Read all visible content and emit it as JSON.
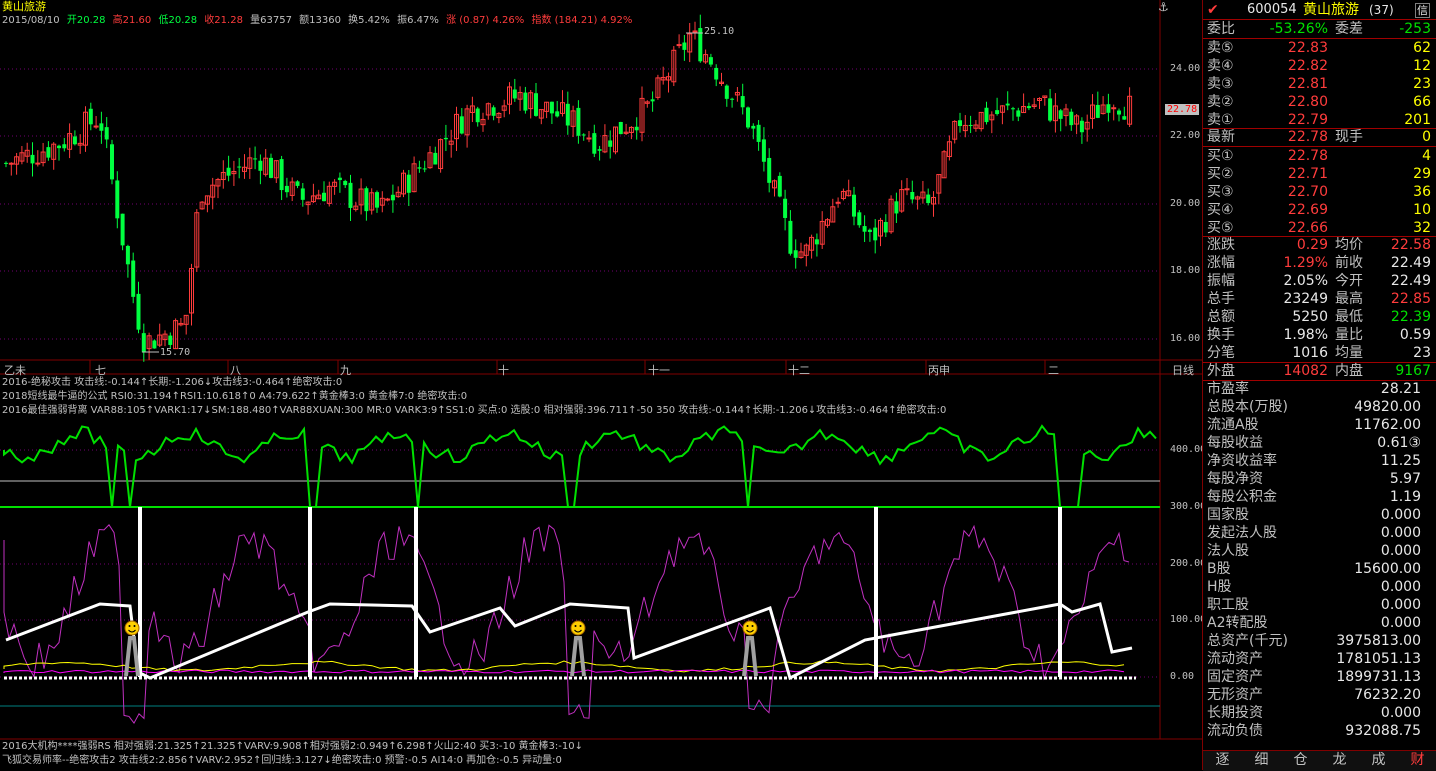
{
  "stock": {
    "name": "黄山旅游",
    "code": "600054",
    "panel_name": "黄山旅游",
    "panel_suffix": "(37)"
  },
  "header": {
    "date": "2015/08/10",
    "open": "开20.28",
    "high": "高21.60",
    "low": "低20.28",
    "close": "收21.28",
    "volume": "量63757",
    "amount": "额13360",
    "turnover": "换5.42%",
    "amplitude": "振6.47%",
    "change": "涨 (0.87) 4.26%",
    "index": "指数 (184.21) 4.92%"
  },
  "price_axis": [
    "24.00",
    "22.00",
    "20.00",
    "18.00",
    "16.00"
  ],
  "current_price_tag": "22.78",
  "max_label": "25.10",
  "min_label": "15.70",
  "month_labels": [
    "乙未",
    "七",
    "八",
    "九",
    "十",
    "十一",
    "十二",
    "丙申",
    "二"
  ],
  "period_label": "日线",
  "ind1": "2016-绝秘攻击 攻击线:-0.144↑长期:-1.206↓攻击线3:-0.464↑绝密攻击:0",
  "ind2": "2018短线最牛逼的公式 RSI0:31.194↑RSI1:10.618↑0 A4:79.622↑黄金棒3:0 黄金棒7:0 绝密攻击:0",
  "ind3": "2016最佳强弱背离 VAR88:105↑VARK1:17↓SM:188.480↑VAR88XUAN:300 MR:0 VARK3:9↑SS1:0 买点:0 选股:0 相对强弱:396.711↑-50 350 攻击线:-0.144↑长期:-1.206↓攻击线3:-0.464↑绝密攻击:0",
  "sub_axis": [
    "400.00",
    "300.00",
    "200.00",
    "100.00",
    "0.00"
  ],
  "bottom1": "2016大机构****强弱RS 相对强弱:21.325↑21.325↑VARV:9.908↑相对强弱2:0.949↑6.298↑火山2:40 买3:-10 黄金棒3:-10↓",
  "bottom2": "飞狐交易师率--绝密攻击2 攻击线2:2.856↑VARV:2.952↑回归线:3.127↓绝密攻击:0 预警:-0.5 AI14:0 再加仓:-0.5 异动量:0",
  "panel": {
    "weibi_label": "委比",
    "weibi_value": "-53.26%",
    "weicha_label": "委差",
    "weicha_value": "-253",
    "sells": [
      {
        "label": "卖⑤",
        "price": "22.83",
        "vol": "62"
      },
      {
        "label": "卖④",
        "price": "22.82",
        "vol": "12"
      },
      {
        "label": "卖③",
        "price": "22.81",
        "vol": "23"
      },
      {
        "label": "卖②",
        "price": "22.80",
        "vol": "66"
      },
      {
        "label": "卖①",
        "price": "22.79",
        "vol": "201"
      }
    ],
    "latest_label": "最新",
    "latest_value": "22.78",
    "xianshou_label": "现手",
    "xianshou_value": "0",
    "buys": [
      {
        "label": "买①",
        "price": "22.78",
        "vol": "4"
      },
      {
        "label": "买②",
        "price": "22.71",
        "vol": "29"
      },
      {
        "label": "买③",
        "price": "22.70",
        "vol": "36"
      },
      {
        "label": "买④",
        "price": "22.69",
        "vol": "10"
      },
      {
        "label": "买⑤",
        "price": "22.66",
        "vol": "32"
      }
    ],
    "stats": [
      {
        "l1": "涨跌",
        "v1": "0.29",
        "c1": "red",
        "l2": "均价",
        "v2": "22.58",
        "c2": "red"
      },
      {
        "l1": "涨幅",
        "v1": "1.29%",
        "c1": "red",
        "l2": "前收",
        "v2": "22.49",
        "c2": "white"
      },
      {
        "l1": "振幅",
        "v1": "2.05%",
        "c1": "white",
        "l2": "今开",
        "v2": "22.49",
        "c2": "white"
      },
      {
        "l1": "总手",
        "v1": "23249",
        "c1": "white",
        "l2": "最高",
        "v2": "22.85",
        "c2": "red"
      },
      {
        "l1": "总额",
        "v1": "5250",
        "c1": "white",
        "l2": "最低",
        "v2": "22.39",
        "c2": "green"
      },
      {
        "l1": "换手",
        "v1": "1.98%",
        "c1": "white",
        "l2": "量比",
        "v2": "0.59",
        "c2": "white"
      },
      {
        "l1": "分笔",
        "v1": "1016",
        "c1": "white",
        "l2": "均量",
        "v2": "23",
        "c2": "white"
      }
    ],
    "waipan_label": "外盘",
    "waipan_value": "14082",
    "neipan_label": "内盘",
    "neipan_value": "9167",
    "fundamentals": [
      {
        "label": "市盈率",
        "value": "28.21"
      },
      {
        "label": "总股本(万股)",
        "value": "49820.00"
      },
      {
        "label": "流通A股",
        "value": "11762.00"
      },
      {
        "label": "每股收益",
        "value": "0.61③"
      },
      {
        "label": "净资收益率",
        "value": "11.25"
      },
      {
        "label": "每股净资",
        "value": "5.97"
      },
      {
        "label": "每股公积金",
        "value": "1.19"
      },
      {
        "label": "国家股",
        "value": "0.000"
      },
      {
        "label": "发起法人股",
        "value": "0.000"
      },
      {
        "label": "法人股",
        "value": "0.000"
      },
      {
        "label": "B股",
        "value": "15600.00"
      },
      {
        "label": "H股",
        "value": "0.000"
      },
      {
        "label": "职工股",
        "value": "0.000"
      },
      {
        "label": "A2转配股",
        "value": "0.000"
      },
      {
        "label": "总资产(千元)",
        "value": "3975813.00"
      },
      {
        "label": "流动资产",
        "value": "1781051.13"
      },
      {
        "label": "固定资产",
        "value": "1899731.13"
      },
      {
        "label": "无形资产",
        "value": "76232.20"
      },
      {
        "label": "长期投资",
        "value": "0.000"
      },
      {
        "label": "流动负债",
        "value": "932088.75"
      }
    ],
    "tabs": [
      "逐",
      "细",
      "仓",
      "龙",
      "成",
      "财"
    ]
  },
  "colors": {
    "up": "#ff3c3c",
    "down": "#00ff40",
    "grid": "#800000",
    "magenta": "#c030c0",
    "yellow": "#ffff00"
  }
}
